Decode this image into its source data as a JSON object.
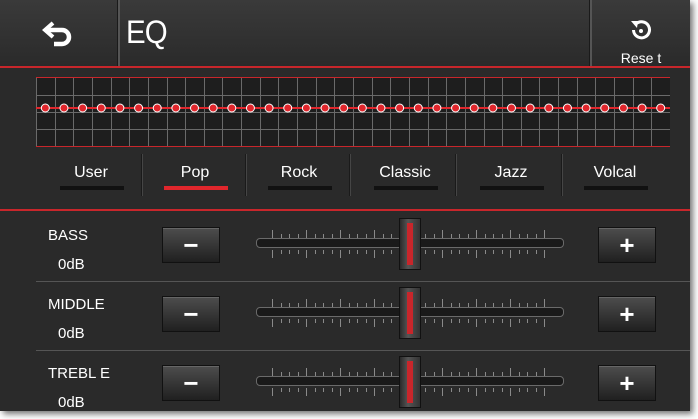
{
  "header": {
    "title": "EQ",
    "reset_label": "Rese t",
    "back_icon": "back-arrow-icon",
    "reset_icon": "reset-icon"
  },
  "colors": {
    "accent": "#e0262c",
    "background": "#2a2a2a"
  },
  "graph": {
    "point_count": 34,
    "level_db": 0
  },
  "presets": [
    {
      "label": "User",
      "active": false
    },
    {
      "label": "Pop",
      "active": true
    },
    {
      "label": "Rock",
      "active": false
    },
    {
      "label": "Classic",
      "active": false
    },
    {
      "label": "Jazz",
      "active": false
    },
    {
      "label": "Volcal",
      "active": false
    }
  ],
  "bands": [
    {
      "name": "BASS",
      "value": "0dB",
      "minus": "−",
      "plus": "+",
      "level": 0.5
    },
    {
      "name": "MIDDLE",
      "value": "0dB",
      "minus": "−",
      "plus": "+",
      "level": 0.5
    },
    {
      "name": "TREBL E",
      "value": "0dB",
      "minus": "−",
      "plus": "+",
      "level": 0.5
    }
  ]
}
